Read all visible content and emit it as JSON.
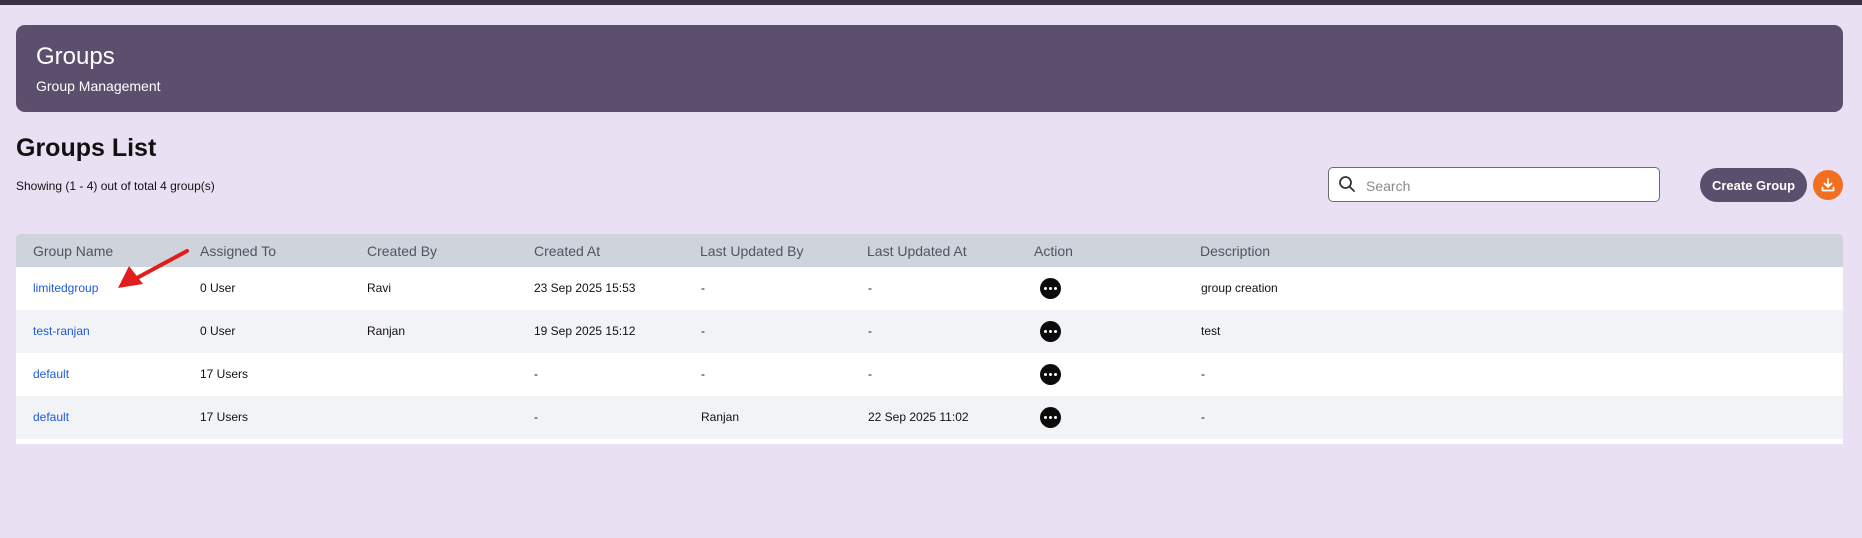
{
  "header": {
    "title": "Groups",
    "subtitle": "Group Management"
  },
  "list": {
    "heading": "Groups List",
    "showing": "Showing (1 - 4) out of total 4 group(s)"
  },
  "toolbar": {
    "search_placeholder": "Search",
    "create_label": "Create Group"
  },
  "table": {
    "columns": [
      "Group Name",
      "Assigned To",
      "Created By",
      "Created At",
      "Last Updated By",
      "Last Updated At",
      "Action",
      "Description"
    ],
    "rows": [
      {
        "name": "limitedgroup",
        "assigned": "0 User",
        "created_by": "Ravi",
        "created_at": "23 Sep 2025 15:53",
        "updated_by": "-",
        "updated_at": "-",
        "description": "group creation"
      },
      {
        "name": "test-ranjan",
        "assigned": "0 User",
        "created_by": "Ranjan",
        "created_at": "19 Sep 2025 15:12",
        "updated_by": "-",
        "updated_at": "-",
        "description": "test"
      },
      {
        "name": "default",
        "assigned": "17 Users",
        "created_by": "",
        "created_at": "-",
        "updated_by": "-",
        "updated_at": "-",
        "description": "-"
      },
      {
        "name": "default",
        "assigned": "17 Users",
        "created_by": "",
        "created_at": "-",
        "updated_by": "Ranjan",
        "updated_at": "22 Sep 2025 11:02",
        "description": "-"
      }
    ]
  },
  "colors": {
    "background": "#e9e1f3",
    "banner": "#5c4f6e",
    "primary_button": "#5c4f6e",
    "download_button": "#f26f21",
    "link": "#1f5bd6",
    "annotation_arrow": "#e11d1d"
  },
  "icons": {
    "search": "search-icon",
    "download": "download-icon",
    "action": "more-options-icon",
    "annotation": "red-arrow-icon"
  }
}
